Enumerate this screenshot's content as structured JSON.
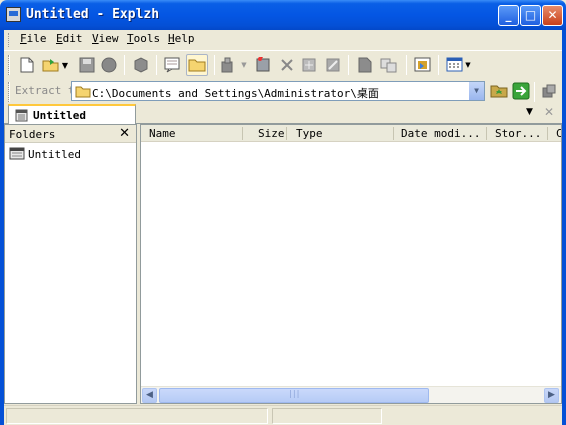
{
  "window": {
    "title": "Untitled - Explzh",
    "minimize_icon": "minimize-icon",
    "maximize_icon": "maximize-icon",
    "close_icon": "close-icon"
  },
  "menu": {
    "items": [
      {
        "label": "File",
        "accel": "F"
      },
      {
        "label": "Edit",
        "accel": "E"
      },
      {
        "label": "View",
        "accel": "V"
      },
      {
        "label": "Tools",
        "accel": "T"
      },
      {
        "label": "Help",
        "accel": "H"
      }
    ]
  },
  "toolbar": {
    "icons": [
      "new-archive-icon",
      "open-archive-icon",
      "save-icon",
      "stop-icon",
      "extract-icon",
      "view-file-icon",
      "open-folder-icon",
      "compress-icon",
      "add-files-icon",
      "delete-icon",
      "test-icon",
      "edit-icon",
      "properties-icon",
      "split-icon",
      "extract-to-icon",
      "view-mode-icon"
    ]
  },
  "address": {
    "label": "Extract to",
    "path": "C:\\Documents and Settings\\Administrator\\桌面",
    "go_icons": [
      "new-folder-icon",
      "go-icon",
      "options-icon"
    ]
  },
  "tabs": [
    {
      "label": "Untitled"
    }
  ],
  "folders": {
    "header": "Folders",
    "close": "✕",
    "nodes": [
      {
        "label": "Untitled"
      }
    ]
  },
  "list": {
    "columns": [
      "Name",
      "Size",
      "Type",
      "Date modi...",
      "Stor...",
      "C"
    ]
  },
  "colors": {
    "titlebar": "#0456e4",
    "tab_accent": "#ffc83c",
    "chrome": "#ece9d8"
  }
}
